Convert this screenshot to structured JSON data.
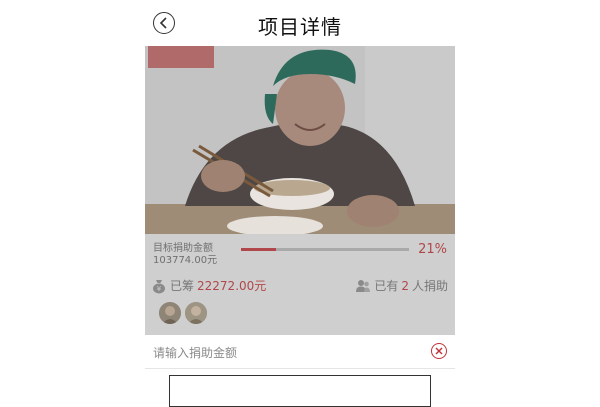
{
  "header": {
    "title": "项目详情"
  },
  "project": {
    "goal_label": "目标捐助金额",
    "goal_amount": "103774.00元",
    "progress": 0.21,
    "progress_label": "21%",
    "raised_prefix": "已筹",
    "raised_amount": "22272.00元",
    "donors_prefix": "已有",
    "donors_count": "2",
    "donors_suffix": "人捐助"
  },
  "donation": {
    "amount_placeholder": "请输入捐助金额"
  },
  "colors": {
    "accent": "#b0474a",
    "clear": "#c0333a"
  }
}
